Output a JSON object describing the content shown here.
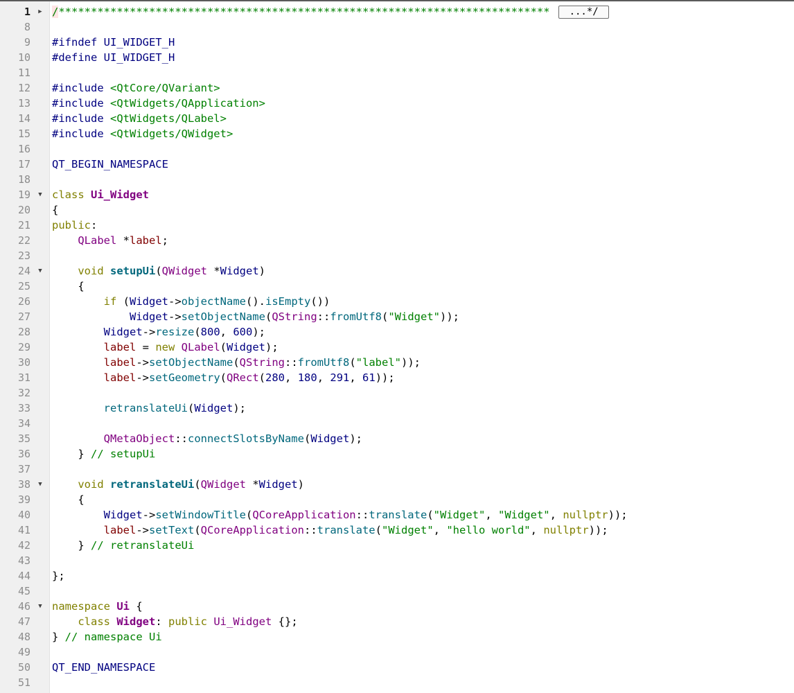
{
  "editor": {
    "lines": [
      {
        "num": "1",
        "fold": "▶",
        "current": true,
        "tokens": [
          [
            "cmt-hl",
            "/"
          ],
          [
            "cmt",
            "****************************************************************************"
          ]
        ],
        "collapsed": "...*/"
      },
      {
        "num": "8",
        "tokens": []
      },
      {
        "num": "9",
        "tokens": [
          [
            "pre",
            "#ifndef UI_WIDGET_H"
          ]
        ]
      },
      {
        "num": "10",
        "tokens": [
          [
            "pre",
            "#define UI_WIDGET_H"
          ]
        ]
      },
      {
        "num": "11",
        "tokens": []
      },
      {
        "num": "12",
        "tokens": [
          [
            "pre",
            "#include "
          ],
          [
            "inc",
            "<QtCore/QVariant>"
          ]
        ]
      },
      {
        "num": "13",
        "tokens": [
          [
            "pre",
            "#include "
          ],
          [
            "inc",
            "<QtWidgets/QApplication>"
          ]
        ]
      },
      {
        "num": "14",
        "tokens": [
          [
            "pre",
            "#include "
          ],
          [
            "inc",
            "<QtWidgets/QLabel>"
          ]
        ]
      },
      {
        "num": "15",
        "tokens": [
          [
            "pre",
            "#include "
          ],
          [
            "inc",
            "<QtWidgets/QWidget>"
          ]
        ]
      },
      {
        "num": "16",
        "tokens": []
      },
      {
        "num": "17",
        "tokens": [
          [
            "plain",
            "QT_BEGIN_NAMESPACE"
          ]
        ]
      },
      {
        "num": "18",
        "tokens": []
      },
      {
        "num": "19",
        "fold": "▼",
        "tokens": [
          [
            "kw",
            "class "
          ],
          [
            "kwb",
            "Ui_Widget"
          ]
        ]
      },
      {
        "num": "20",
        "tokens": [
          [
            "op",
            "{"
          ]
        ]
      },
      {
        "num": "21",
        "tokens": [
          [
            "kw",
            "public"
          ],
          [
            "op",
            ":"
          ]
        ]
      },
      {
        "num": "22",
        "tokens": [
          [
            "plain",
            "    "
          ],
          [
            "cls",
            "QLabel"
          ],
          [
            "op",
            " *"
          ],
          [
            "var",
            "label"
          ],
          [
            "op",
            ";"
          ]
        ]
      },
      {
        "num": "23",
        "tokens": []
      },
      {
        "num": "24",
        "fold": "▼",
        "tokens": [
          [
            "plain",
            "    "
          ],
          [
            "kw",
            "void "
          ],
          [
            "def",
            "setupUi"
          ],
          [
            "op",
            "("
          ],
          [
            "cls",
            "QWidget"
          ],
          [
            "op",
            " *"
          ],
          [
            "plain",
            "Widget"
          ],
          [
            "op",
            ")"
          ]
        ]
      },
      {
        "num": "25",
        "tokens": [
          [
            "plain",
            "    "
          ],
          [
            "op",
            "{"
          ]
        ]
      },
      {
        "num": "26",
        "tokens": [
          [
            "plain",
            "        "
          ],
          [
            "kw",
            "if "
          ],
          [
            "op",
            "("
          ],
          [
            "plain",
            "Widget"
          ],
          [
            "op",
            "->"
          ],
          [
            "fn",
            "objectName"
          ],
          [
            "op",
            "()."
          ],
          [
            "fn",
            "isEmpty"
          ],
          [
            "op",
            "())"
          ]
        ]
      },
      {
        "num": "27",
        "tokens": [
          [
            "plain",
            "            Widget"
          ],
          [
            "op",
            "->"
          ],
          [
            "fn",
            "setObjectName"
          ],
          [
            "op",
            "("
          ],
          [
            "cls",
            "QString"
          ],
          [
            "op",
            "::"
          ],
          [
            "fn",
            "fromUtf8"
          ],
          [
            "op",
            "("
          ],
          [
            "str",
            "\"Widget\""
          ],
          [
            "op",
            "));"
          ]
        ]
      },
      {
        "num": "28",
        "tokens": [
          [
            "plain",
            "        Widget"
          ],
          [
            "op",
            "->"
          ],
          [
            "fn",
            "resize"
          ],
          [
            "op",
            "("
          ],
          [
            "num",
            "800"
          ],
          [
            "op",
            ", "
          ],
          [
            "num",
            "600"
          ],
          [
            "op",
            ");"
          ]
        ]
      },
      {
        "num": "29",
        "tokens": [
          [
            "plain",
            "        "
          ],
          [
            "var",
            "label"
          ],
          [
            "op",
            " = "
          ],
          [
            "kw",
            "new "
          ],
          [
            "cls",
            "QLabel"
          ],
          [
            "op",
            "("
          ],
          [
            "plain",
            "Widget"
          ],
          [
            "op",
            ");"
          ]
        ]
      },
      {
        "num": "30",
        "tokens": [
          [
            "plain",
            "        "
          ],
          [
            "var",
            "label"
          ],
          [
            "op",
            "->"
          ],
          [
            "fn",
            "setObjectName"
          ],
          [
            "op",
            "("
          ],
          [
            "cls",
            "QString"
          ],
          [
            "op",
            "::"
          ],
          [
            "fn",
            "fromUtf8"
          ],
          [
            "op",
            "("
          ],
          [
            "str",
            "\"label\""
          ],
          [
            "op",
            "));"
          ]
        ]
      },
      {
        "num": "31",
        "tokens": [
          [
            "plain",
            "        "
          ],
          [
            "var",
            "label"
          ],
          [
            "op",
            "->"
          ],
          [
            "fn",
            "setGeometry"
          ],
          [
            "op",
            "("
          ],
          [
            "cls",
            "QRect"
          ],
          [
            "op",
            "("
          ],
          [
            "num",
            "280"
          ],
          [
            "op",
            ", "
          ],
          [
            "num",
            "180"
          ],
          [
            "op",
            ", "
          ],
          [
            "num",
            "291"
          ],
          [
            "op",
            ", "
          ],
          [
            "num",
            "61"
          ],
          [
            "op",
            "));"
          ]
        ]
      },
      {
        "num": "32",
        "tokens": []
      },
      {
        "num": "33",
        "tokens": [
          [
            "plain",
            "        "
          ],
          [
            "fn",
            "retranslateUi"
          ],
          [
            "op",
            "("
          ],
          [
            "plain",
            "Widget"
          ],
          [
            "op",
            ");"
          ]
        ]
      },
      {
        "num": "34",
        "tokens": []
      },
      {
        "num": "35",
        "tokens": [
          [
            "plain",
            "        "
          ],
          [
            "cls",
            "QMetaObject"
          ],
          [
            "op",
            "::"
          ],
          [
            "fn",
            "connectSlotsByName"
          ],
          [
            "op",
            "("
          ],
          [
            "plain",
            "Widget"
          ],
          [
            "op",
            ");"
          ]
        ]
      },
      {
        "num": "36",
        "tokens": [
          [
            "plain",
            "    "
          ],
          [
            "op",
            "} "
          ],
          [
            "cmt",
            "// setupUi"
          ]
        ]
      },
      {
        "num": "37",
        "tokens": []
      },
      {
        "num": "38",
        "fold": "▼",
        "tokens": [
          [
            "plain",
            "    "
          ],
          [
            "kw",
            "void "
          ],
          [
            "def",
            "retranslateUi"
          ],
          [
            "op",
            "("
          ],
          [
            "cls",
            "QWidget"
          ],
          [
            "op",
            " *"
          ],
          [
            "plain",
            "Widget"
          ],
          [
            "op",
            ")"
          ]
        ]
      },
      {
        "num": "39",
        "tokens": [
          [
            "plain",
            "    "
          ],
          [
            "op",
            "{"
          ]
        ]
      },
      {
        "num": "40",
        "tokens": [
          [
            "plain",
            "        Widget"
          ],
          [
            "op",
            "->"
          ],
          [
            "fn",
            "setWindowTitle"
          ],
          [
            "op",
            "("
          ],
          [
            "cls",
            "QCoreApplication"
          ],
          [
            "op",
            "::"
          ],
          [
            "fn",
            "translate"
          ],
          [
            "op",
            "("
          ],
          [
            "str",
            "\"Widget\""
          ],
          [
            "op",
            ", "
          ],
          [
            "str",
            "\"Widget\""
          ],
          [
            "op",
            ", "
          ],
          [
            "kw",
            "nullptr"
          ],
          [
            "op",
            "));"
          ]
        ]
      },
      {
        "num": "41",
        "tokens": [
          [
            "plain",
            "        "
          ],
          [
            "var",
            "label"
          ],
          [
            "op",
            "->"
          ],
          [
            "fn",
            "setText"
          ],
          [
            "op",
            "("
          ],
          [
            "cls",
            "QCoreApplication"
          ],
          [
            "op",
            "::"
          ],
          [
            "fn",
            "translate"
          ],
          [
            "op",
            "("
          ],
          [
            "str",
            "\"Widget\""
          ],
          [
            "op",
            ", "
          ],
          [
            "str",
            "\"hello world\""
          ],
          [
            "op",
            ", "
          ],
          [
            "kw",
            "nullptr"
          ],
          [
            "op",
            "));"
          ]
        ]
      },
      {
        "num": "42",
        "tokens": [
          [
            "plain",
            "    "
          ],
          [
            "op",
            "} "
          ],
          [
            "cmt",
            "// retranslateUi"
          ]
        ]
      },
      {
        "num": "43",
        "tokens": []
      },
      {
        "num": "44",
        "tokens": [
          [
            "op",
            "};"
          ]
        ]
      },
      {
        "num": "45",
        "tokens": []
      },
      {
        "num": "46",
        "fold": "▼",
        "tokens": [
          [
            "kw",
            "namespace "
          ],
          [
            "kwb",
            "Ui"
          ],
          [
            "op",
            " {"
          ]
        ]
      },
      {
        "num": "47",
        "tokens": [
          [
            "plain",
            "    "
          ],
          [
            "kw",
            "class "
          ],
          [
            "kwb",
            "Widget"
          ],
          [
            "op",
            ": "
          ],
          [
            "kw",
            "public "
          ],
          [
            "cls",
            "Ui_Widget"
          ],
          [
            "op",
            " {};"
          ]
        ]
      },
      {
        "num": "48",
        "tokens": [
          [
            "op",
            "} "
          ],
          [
            "cmt",
            "// namespace Ui"
          ]
        ]
      },
      {
        "num": "49",
        "tokens": []
      },
      {
        "num": "50",
        "tokens": [
          [
            "plain",
            "QT_END_NAMESPACE"
          ]
        ]
      },
      {
        "num": "51",
        "tokens": []
      }
    ]
  },
  "colors": {
    "keyword": "#808000",
    "type": "#800080",
    "function": "#00677c",
    "string": "#008000",
    "comment": "#008000",
    "member": "#800000",
    "identifier": "#000080",
    "gutter_bg": "#f0f0f0"
  },
  "icons": {
    "fold_expanded": "triangle-down-icon",
    "fold_collapsed": "triangle-right-icon"
  }
}
